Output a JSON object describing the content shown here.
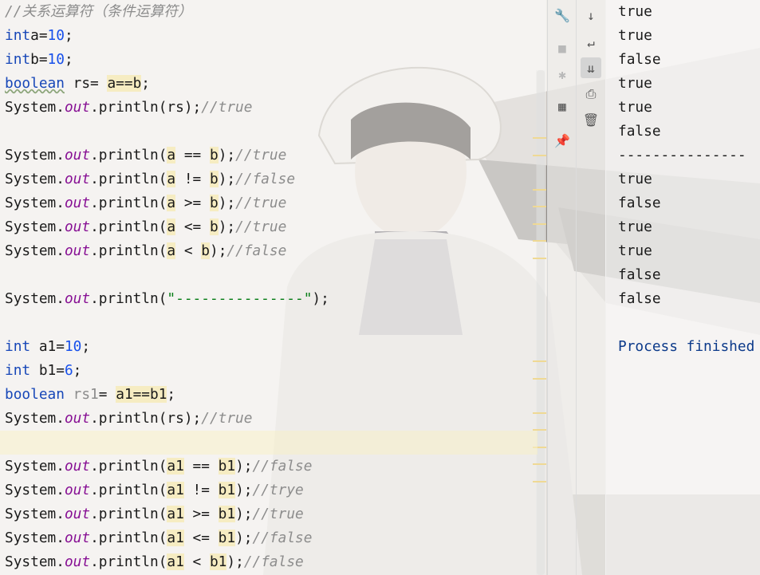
{
  "editor": {
    "lines": [
      {
        "t": "c",
        "parts": [
          [
            "cmt",
            "//关系运算符（条件运算符）"
          ]
        ]
      },
      {
        "t": "c",
        "parts": [
          [
            "kw",
            "int"
          ],
          [
            "",
            "a="
          ],
          [
            "num",
            "10"
          ],
          [
            "",
            ";"
          ]
        ]
      },
      {
        "t": "c",
        "parts": [
          [
            "kw",
            "int"
          ],
          [
            "",
            "b="
          ],
          [
            "num",
            "10"
          ],
          [
            "",
            ";"
          ]
        ]
      },
      {
        "t": "c",
        "parts": [
          [
            "kw typo",
            "boolean"
          ],
          [
            "",
            " rs= "
          ],
          [
            "hl",
            "a==b"
          ],
          [
            "",
            ";"
          ]
        ]
      },
      {
        "t": "c",
        "parts": [
          [
            "",
            "System."
          ],
          [
            "fld",
            "out"
          ],
          [
            "",
            ".println(rs);"
          ],
          [
            "cmt",
            "//true"
          ]
        ]
      },
      {
        "t": "blank"
      },
      {
        "t": "c",
        "parts": [
          [
            "",
            "System."
          ],
          [
            "fld",
            "out"
          ],
          [
            "",
            ".println("
          ],
          [
            "hl",
            "a"
          ],
          [
            "",
            " == "
          ],
          [
            "hl",
            "b"
          ],
          [
            "",
            ");"
          ],
          [
            "cmt",
            "//true"
          ]
        ]
      },
      {
        "t": "c",
        "parts": [
          [
            "",
            "System."
          ],
          [
            "fld",
            "out"
          ],
          [
            "",
            ".println("
          ],
          [
            "hl",
            "a"
          ],
          [
            "",
            " != "
          ],
          [
            "hl",
            "b"
          ],
          [
            "",
            ");"
          ],
          [
            "cmt",
            "//false"
          ]
        ]
      },
      {
        "t": "c",
        "parts": [
          [
            "",
            "System."
          ],
          [
            "fld",
            "out"
          ],
          [
            "",
            ".println("
          ],
          [
            "hl",
            "a"
          ],
          [
            "",
            " >= "
          ],
          [
            "hl",
            "b"
          ],
          [
            "",
            ");"
          ],
          [
            "cmt",
            "//true"
          ]
        ]
      },
      {
        "t": "c",
        "parts": [
          [
            "",
            "System."
          ],
          [
            "fld",
            "out"
          ],
          [
            "",
            ".println("
          ],
          [
            "hl",
            "a"
          ],
          [
            "",
            " <= "
          ],
          [
            "hl",
            "b"
          ],
          [
            "",
            ");"
          ],
          [
            "cmt",
            "//true"
          ]
        ]
      },
      {
        "t": "c",
        "parts": [
          [
            "",
            "System."
          ],
          [
            "fld",
            "out"
          ],
          [
            "",
            ".println("
          ],
          [
            "hl",
            "a"
          ],
          [
            "",
            " < "
          ],
          [
            "hl",
            "b"
          ],
          [
            "",
            ");"
          ],
          [
            "cmt",
            "//false"
          ]
        ]
      },
      {
        "t": "blank"
      },
      {
        "t": "c",
        "parts": [
          [
            "",
            "System."
          ],
          [
            "fld",
            "out"
          ],
          [
            "",
            ".println("
          ],
          [
            "str",
            "\"---------------\""
          ],
          [
            "",
            ");"
          ]
        ]
      },
      {
        "t": "blank"
      },
      {
        "t": "c",
        "parts": [
          [
            "kw",
            "int"
          ],
          [
            "",
            " a1="
          ],
          [
            "num",
            "10"
          ],
          [
            "",
            ";"
          ]
        ]
      },
      {
        "t": "c",
        "parts": [
          [
            "kw",
            "int"
          ],
          [
            "",
            " b1="
          ],
          [
            "num",
            "6"
          ],
          [
            "",
            ";"
          ]
        ]
      },
      {
        "t": "c",
        "parts": [
          [
            "kw",
            "boolean"
          ],
          [
            "cmt-plain",
            " rs1"
          ],
          [
            "",
            "= "
          ],
          [
            "hl",
            "a1==b1"
          ],
          [
            "",
            ";"
          ]
        ]
      },
      {
        "t": "c",
        "parts": [
          [
            "",
            "System."
          ],
          [
            "fld",
            "out"
          ],
          [
            "",
            ".println(rs);"
          ],
          [
            "cmt",
            "//true"
          ]
        ]
      },
      {
        "t": "current"
      },
      {
        "t": "c",
        "parts": [
          [
            "",
            "System."
          ],
          [
            "fld",
            "out"
          ],
          [
            "",
            ".println("
          ],
          [
            "hl",
            "a1"
          ],
          [
            "",
            " == "
          ],
          [
            "hl",
            "b1"
          ],
          [
            "",
            ");"
          ],
          [
            "cmt",
            "//false"
          ]
        ]
      },
      {
        "t": "c",
        "parts": [
          [
            "",
            "System."
          ],
          [
            "fld",
            "out"
          ],
          [
            "",
            ".println("
          ],
          [
            "hl",
            "a1"
          ],
          [
            "",
            " != "
          ],
          [
            "hl",
            "b1"
          ],
          [
            "",
            ");"
          ],
          [
            "cmt",
            "//trye"
          ]
        ]
      },
      {
        "t": "c",
        "parts": [
          [
            "",
            "System."
          ],
          [
            "fld",
            "out"
          ],
          [
            "",
            ".println("
          ],
          [
            "hl",
            "a1"
          ],
          [
            "",
            " >= "
          ],
          [
            "hl",
            "b1"
          ],
          [
            "",
            ");"
          ],
          [
            "cmt",
            "//true"
          ]
        ]
      },
      {
        "t": "c",
        "parts": [
          [
            "",
            "System."
          ],
          [
            "fld",
            "out"
          ],
          [
            "",
            ".println("
          ],
          [
            "hl",
            "a1"
          ],
          [
            "",
            " <= "
          ],
          [
            "hl",
            "b1"
          ],
          [
            "",
            ");"
          ],
          [
            "cmt",
            "//false"
          ]
        ]
      },
      {
        "t": "c",
        "parts": [
          [
            "",
            "System."
          ],
          [
            "fld",
            "out"
          ],
          [
            "",
            ".println("
          ],
          [
            "hl",
            "a1"
          ],
          [
            "",
            " < "
          ],
          [
            "hl",
            "b1"
          ],
          [
            "",
            ");"
          ],
          [
            "cmt",
            "//false"
          ]
        ]
      }
    ]
  },
  "run_toolbar": {
    "left": [
      {
        "name": "wrench-icon",
        "glyph": "🔧",
        "state": "normal"
      },
      {
        "name": "stop-icon",
        "glyph": "■",
        "state": "disabled"
      },
      {
        "name": "debug-bug-icon",
        "glyph": "✱",
        "state": "disabled"
      },
      {
        "name": "layout-icon",
        "glyph": "▦",
        "state": "normal"
      },
      {
        "name": "pin-icon",
        "glyph": "📌",
        "state": "normal"
      }
    ],
    "right": [
      {
        "name": "scroll-down-arrow-icon",
        "glyph": "↓",
        "state": "normal"
      },
      {
        "name": "soft-wrap-icon",
        "glyph": "↵",
        "state": "normal"
      },
      {
        "name": "scroll-to-end-icon",
        "glyph": "⇊",
        "state": "active"
      },
      {
        "name": "print-icon",
        "glyph": "⎙",
        "state": "normal"
      },
      {
        "name": "trash-icon",
        "glyph": "🗑",
        "state": "normal"
      }
    ]
  },
  "console": {
    "lines": [
      "true",
      "true",
      "false",
      "true",
      "true",
      "false",
      "---------------",
      "true",
      "false",
      "true",
      "true",
      "false",
      "false",
      "",
      "Process finished"
    ]
  },
  "colors": {
    "keyword": "#1747b8",
    "number": "#1750eb",
    "field": "#871094",
    "string": "#067d17",
    "comment": "#8c8c8c",
    "highlight": "#f6e9b2",
    "stripe": "#e2b21c"
  }
}
